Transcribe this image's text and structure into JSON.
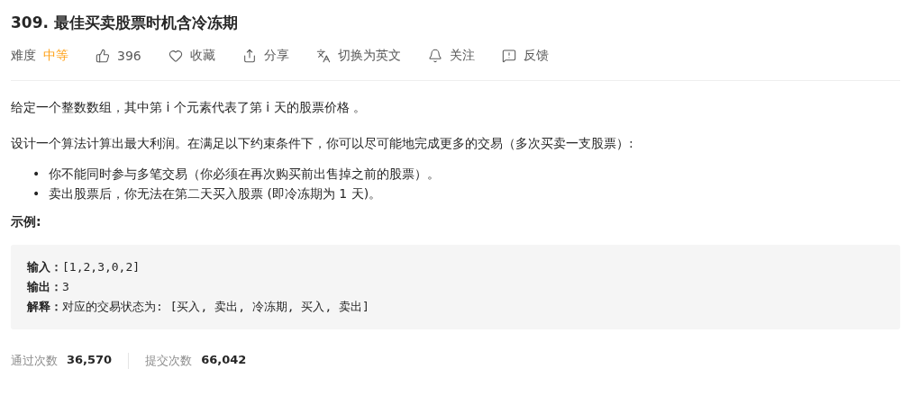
{
  "title": "309. 最佳买卖股票时机含冷冻期",
  "difficulty": {
    "label": "难度",
    "value": "中等",
    "color": "#ffa116"
  },
  "actions": [
    {
      "kind": "like",
      "label": "396"
    },
    {
      "kind": "favorite",
      "label": "收藏"
    },
    {
      "kind": "share",
      "label": "分享"
    },
    {
      "kind": "translate",
      "label": "切换为英文"
    },
    {
      "kind": "follow",
      "label": "关注"
    },
    {
      "kind": "feedback",
      "label": "反馈"
    }
  ],
  "paragraphs": [
    "给定一个整数数组，其中第 i 个元素代表了第 i 天的股票价格 。",
    "设计一个算法计算出最大利润。在满足以下约束条件下，你可以尽可能地完成更多的交易（多次买卖一支股票）:"
  ],
  "bullets": [
    {
      "marker": "•",
      "text": "你不能同时参与多笔交易（你必须在再次购买前出售掉之前的股票）。"
    },
    {
      "marker": "•",
      "text": "卖出股票后，你无法在第二天买入股票 (即冷冻期为 1 天)。"
    }
  ],
  "example_heading": "示例:",
  "example": [
    {
      "label": "输入：",
      "value": "[1,2,3,0,2]"
    },
    {
      "label": "输出：",
      "value": "3"
    },
    {
      "label": "解释：",
      "value": "对应的交易状态为: [买入, 卖出, 冷冻期, 买入, 卖出]"
    }
  ],
  "stats": [
    {
      "label": "通过次数",
      "value": "36,570"
    },
    {
      "label": "提交次数",
      "value": "66,042"
    }
  ]
}
